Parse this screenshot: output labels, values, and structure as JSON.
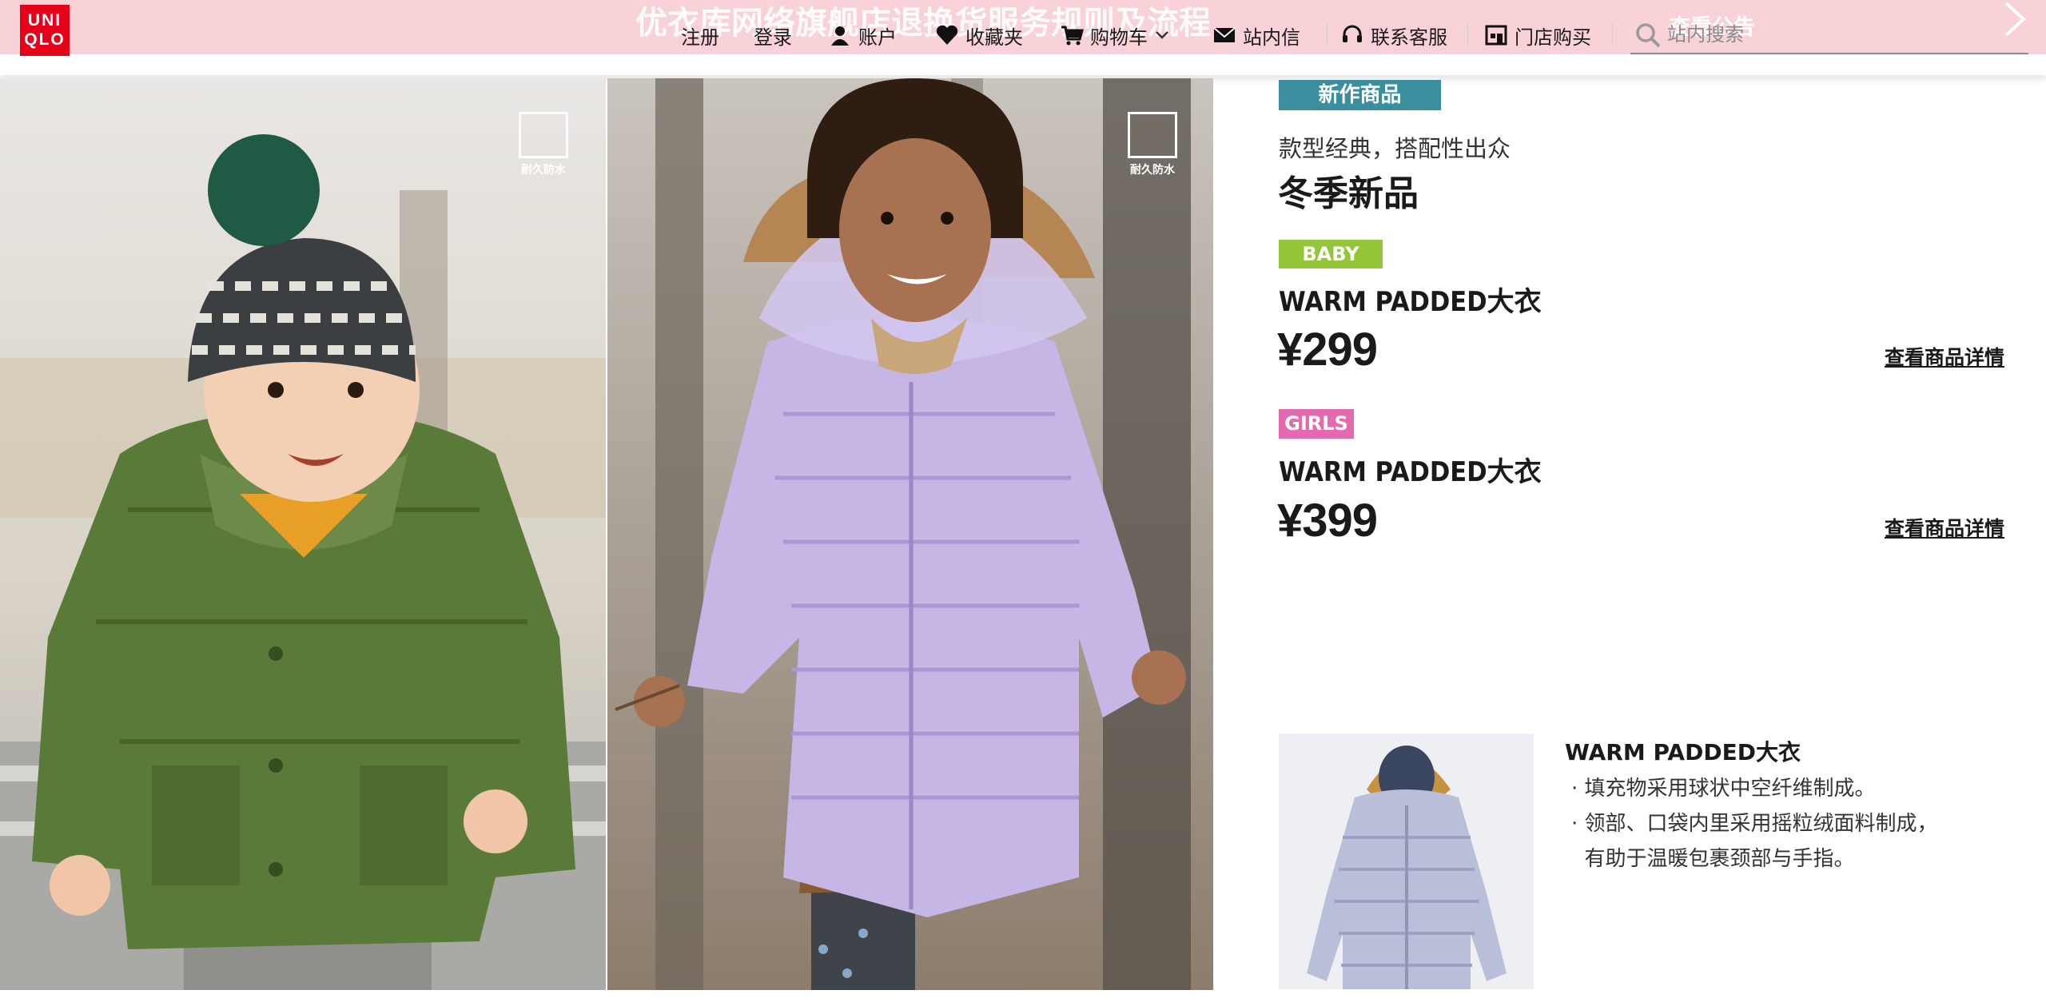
{
  "header": {
    "logo_text_line1": "UNI",
    "logo_text_line2": "QLO",
    "announcement": "优衣库网络旗舰店退换货服务规则及流程",
    "announcement_link": "查看公告",
    "nav": {
      "register": "注册",
      "login": "登录",
      "account": "账户",
      "favorites": "收藏夹",
      "cart": "购物车",
      "messages": "站内信",
      "support": "联系客服",
      "store": "门店购买"
    },
    "search_placeholder": "站内搜索"
  },
  "photos": {
    "baby_badge": "耐久防水",
    "girl_badge": "耐久防水"
  },
  "product_panel": {
    "new_tag": "新作商品",
    "subtitle": "款型经典，搭配性出众",
    "headline": "冬季新品",
    "items": [
      {
        "tag": "BABY",
        "name": "WARM PADDED大衣",
        "price": "¥299",
        "detail_link": "查看商品详情",
        "tag_color": "#93c638"
      },
      {
        "tag": "GIRLS",
        "name": "WARM PADDED大衣",
        "price": "¥399",
        "detail_link": "查看商品详情",
        "tag_color": "#e46ab0"
      }
    ]
  },
  "feature": {
    "title": "WARM PADDED大衣",
    "bullets": [
      "· 填充物采用球状中空纤维制成。",
      "· 领部、口袋内里采用摇粒绒面料制成，",
      "  有助于温暖包裹颈部与手指。"
    ]
  },
  "colors": {
    "brand_red": "#e6001a",
    "topbar_pink": "#f9d2d8",
    "new_tag": "#3a8e9e"
  }
}
